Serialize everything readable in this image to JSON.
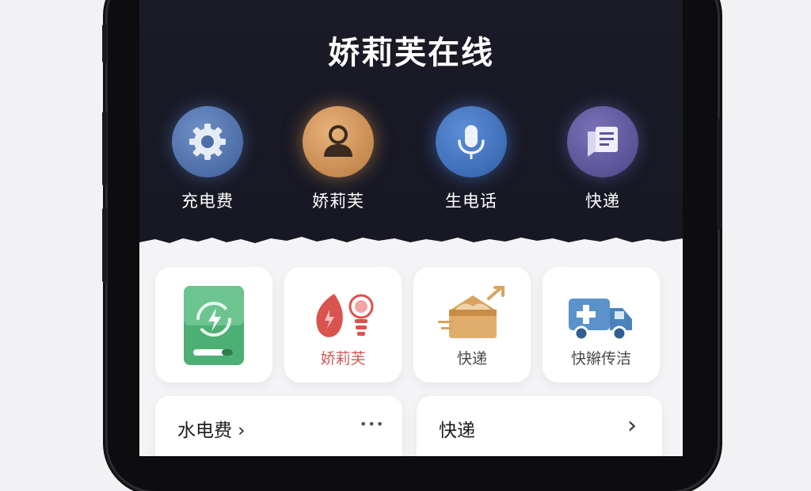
{
  "app": {
    "title": "娇莉芙在线"
  },
  "top_menu": [
    {
      "label": "充电费",
      "icon": "gear-icon"
    },
    {
      "label": "娇莉芙",
      "icon": "user-icon"
    },
    {
      "label": "生电话",
      "icon": "microphone-icon"
    },
    {
      "label": "快递",
      "icon": "message-icon"
    }
  ],
  "services": [
    {
      "label": "",
      "icon": "battery-charge-icon"
    },
    {
      "label": "娇莉芙",
      "icon": "lightbulb-icon"
    },
    {
      "label": "快递",
      "icon": "package-icon"
    },
    {
      "label": "快辮传洁",
      "icon": "delivery-truck-icon"
    }
  ],
  "rows": [
    {
      "label": "水电费 ›",
      "action": "more-icon"
    },
    {
      "label": "快递",
      "action": "chevron-right-icon"
    }
  ],
  "more_glyph": "•••",
  "chevron_glyph": "›",
  "colors": {
    "header_bg": "#1a1b27",
    "gear": "#4d6da8",
    "user": "#c88b4d",
    "mic": "#3c6cb8",
    "doc": "#5b5597",
    "battery_green": "#4caf73",
    "accent_red": "#d05a55",
    "truck_blue": "#5b92c9"
  }
}
